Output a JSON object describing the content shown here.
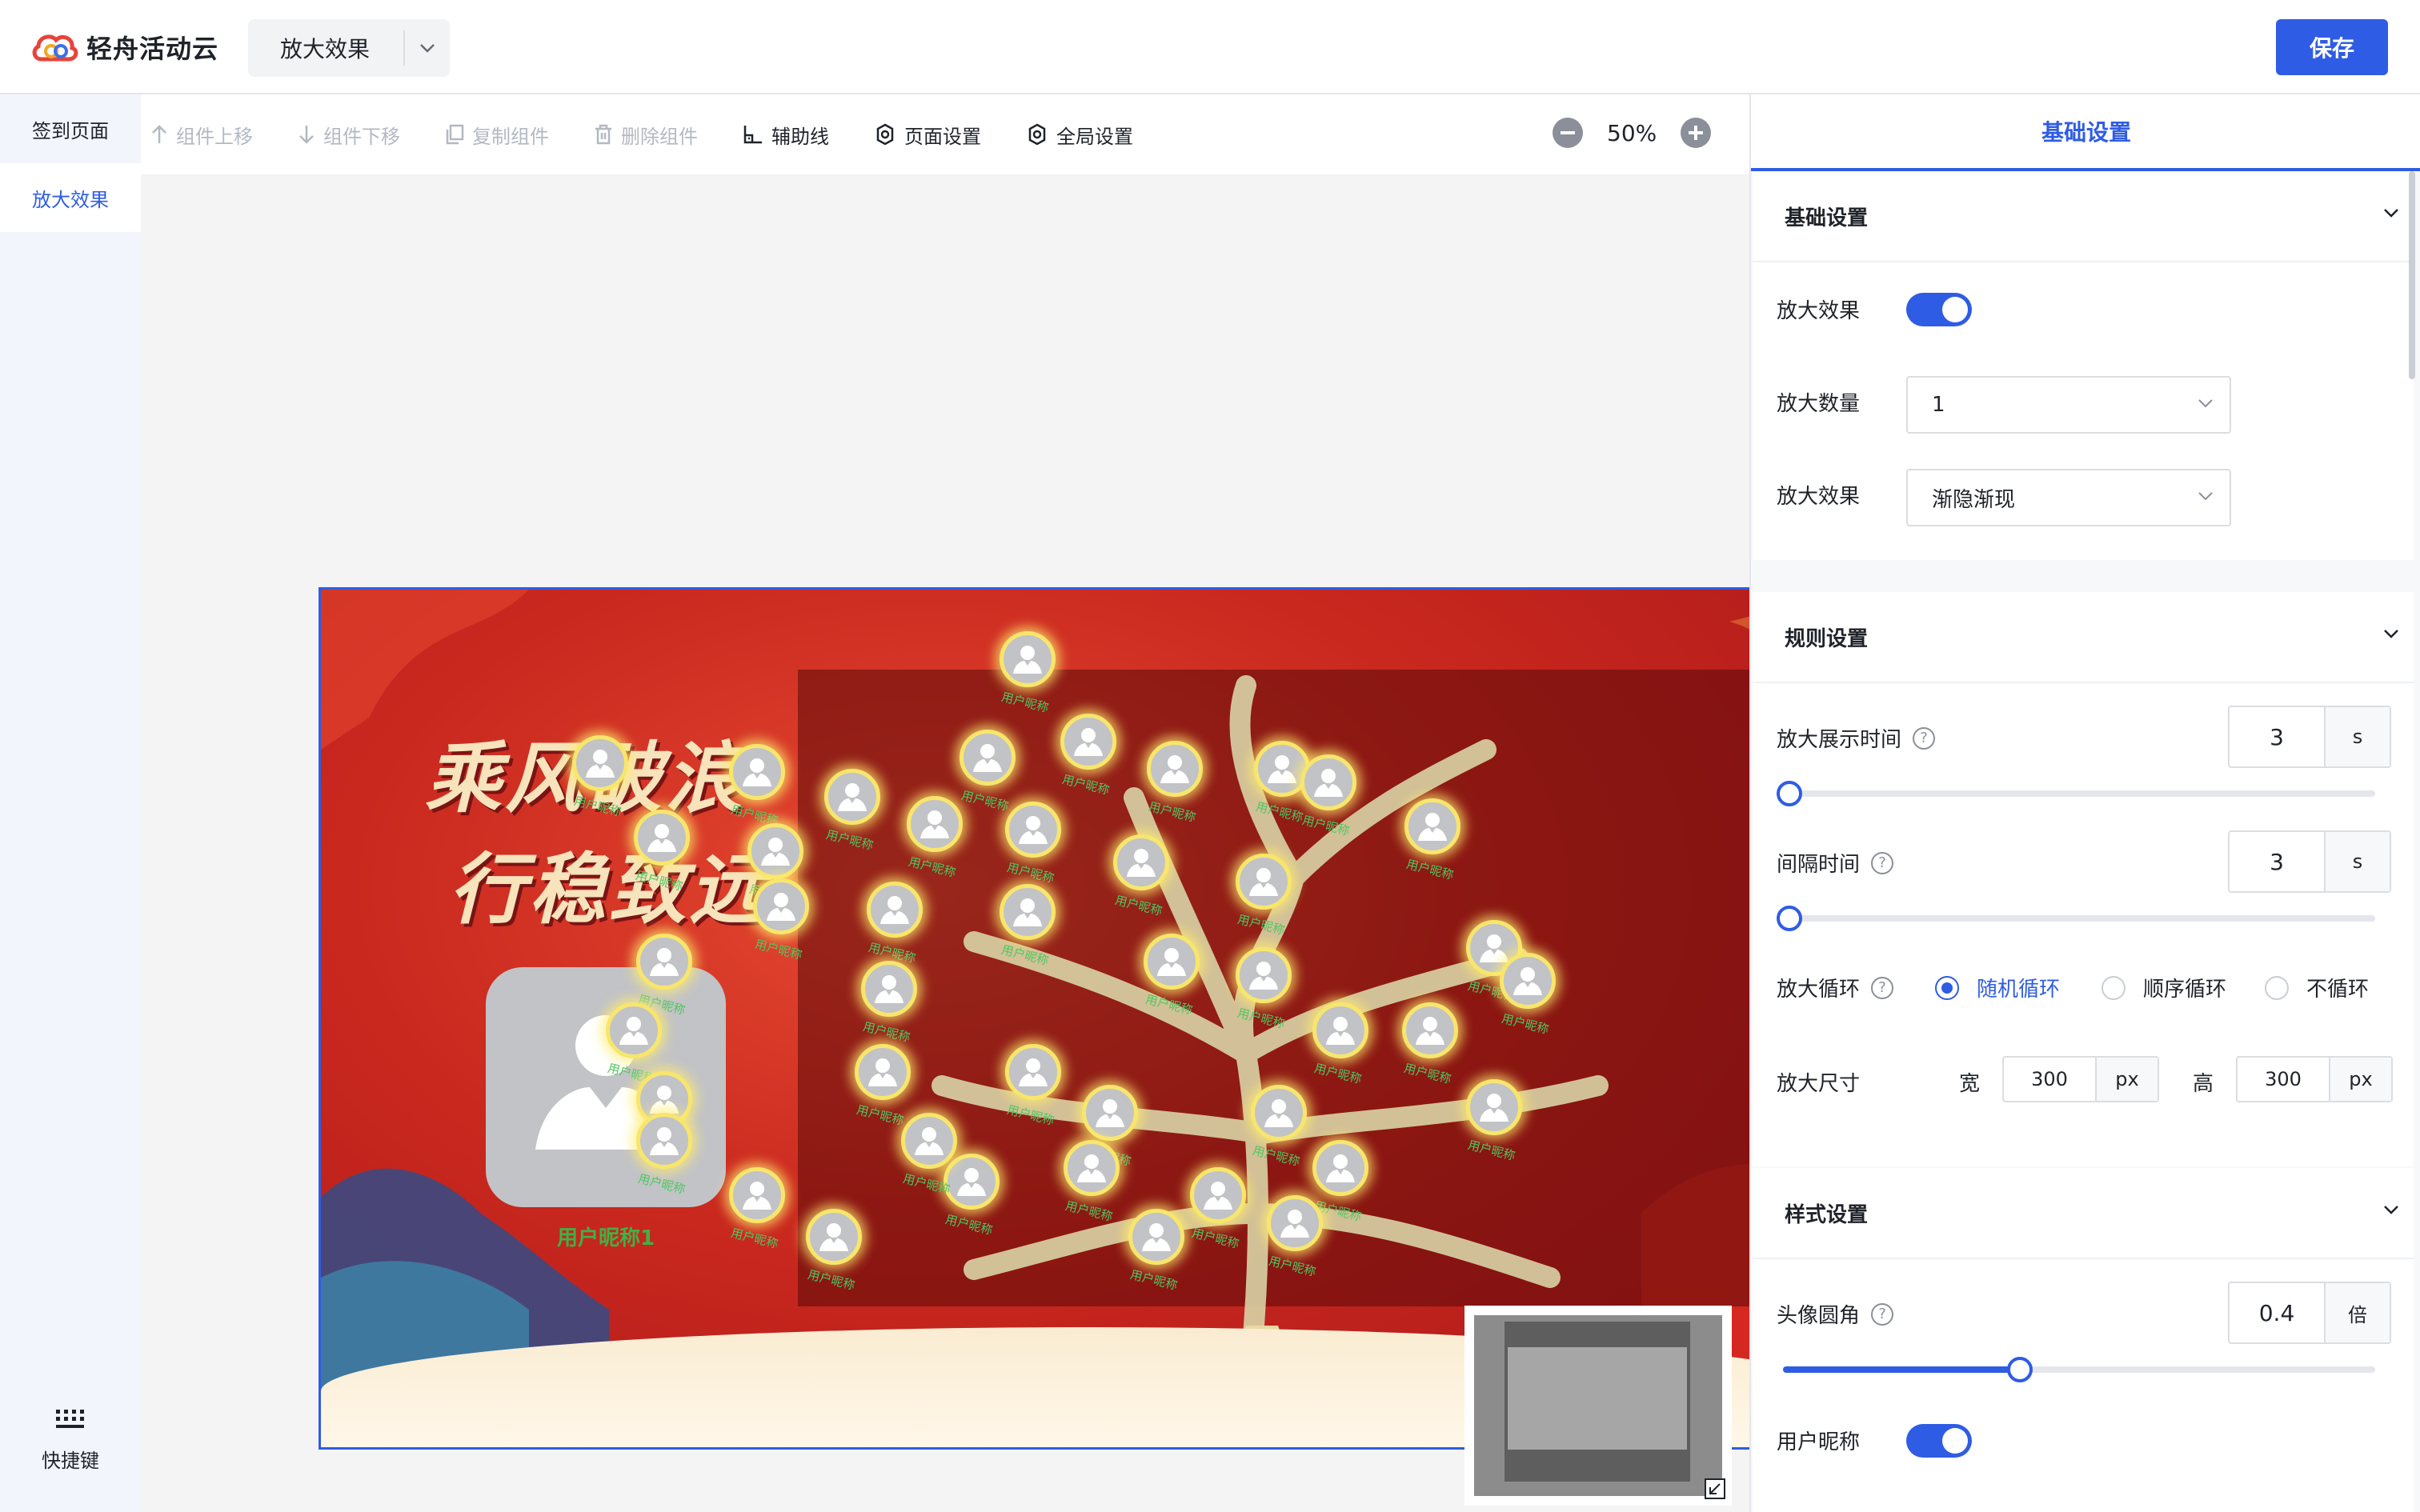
{
  "app": {
    "name": "轻舟活动云"
  },
  "header": {
    "page_select": "放大效果",
    "save_label": "保存"
  },
  "sidebar": {
    "items": [
      {
        "label": "签到页面",
        "active": false
      },
      {
        "label": "放大效果",
        "active": true
      }
    ],
    "shortcut_label": "快捷键"
  },
  "toolbar": {
    "move_up": "组件上移",
    "move_down": "组件下移",
    "copy": "复制组件",
    "delete": "删除组件",
    "guides": "辅助线",
    "page_settings": "页面设置",
    "global_settings": "全局设置",
    "zoom": "50%"
  },
  "stage": {
    "title_line1": "乘风破浪",
    "title_line2": "行稳致远",
    "featured_name": "用户昵称1",
    "mini_name": "用户昵称"
  },
  "panel": {
    "tab": "基础设置",
    "basic": {
      "title": "基础设置",
      "zoom_effect_label": "放大效果",
      "zoom_effect_on": true,
      "zoom_count_label": "放大数量",
      "zoom_count_value": "1",
      "zoom_anim_label": "放大效果",
      "zoom_anim_value": "渐隐渐现"
    },
    "rules": {
      "title": "规则设置",
      "show_time_label": "放大展示时间",
      "show_time_value": "3",
      "show_time_unit": "s",
      "interval_label": "间隔时间",
      "interval_value": "3",
      "interval_unit": "s",
      "loop_label": "放大循环",
      "loop_options": [
        "随机循环",
        "顺序循环",
        "不循环"
      ],
      "loop_selected": "随机循环",
      "size_label": "放大尺寸",
      "width_label": "宽",
      "width_value": "300",
      "width_unit": "px",
      "height_label": "高",
      "height_value": "300",
      "height_unit": "px"
    },
    "style": {
      "title": "样式设置",
      "radius_label": "头像圆角",
      "radius_value": "0.4",
      "radius_unit": "倍",
      "radius_fraction": 0.4,
      "nickname_label": "用户昵称",
      "nickname_on": true
    }
  },
  "colors": {
    "accent": "#2f5ce4",
    "stage_red": "#c9281e",
    "name_green": "#3fb145"
  }
}
